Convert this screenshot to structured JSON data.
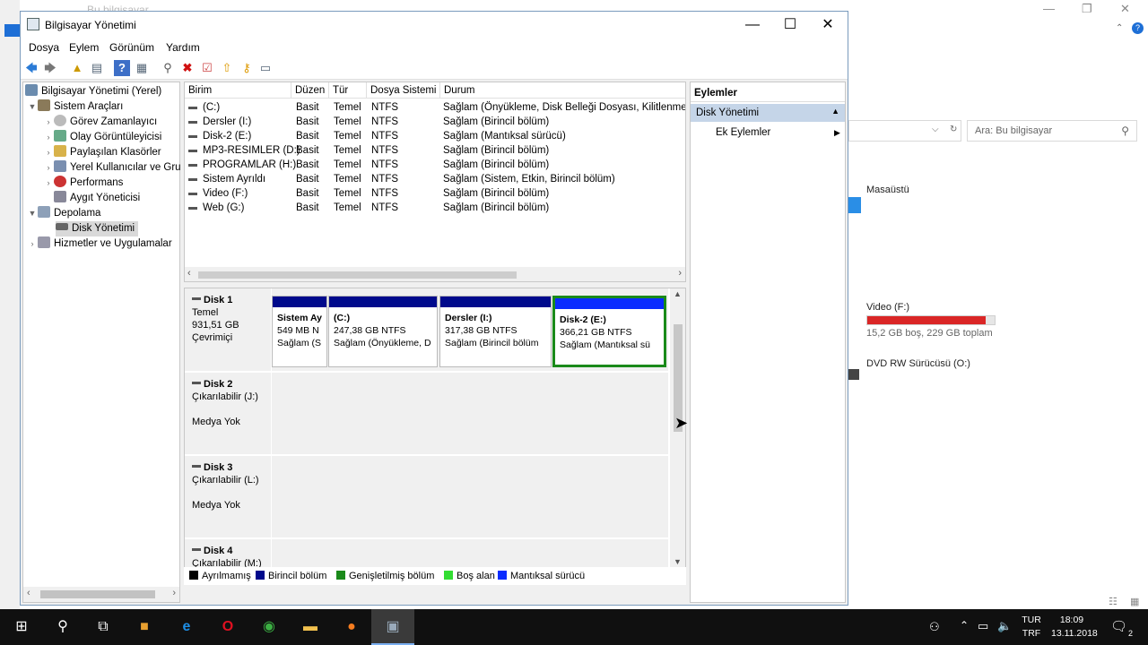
{
  "background_window": {
    "title": "Bu bilgisayar",
    "search_placeholder": "Ara: Bu bilgisayar",
    "items": {
      "desktop": "Masaüstü",
      "video_drive": "Video (F:)",
      "video_free": "15,2 GB boş, 229 GB toplam",
      "video_used_fraction": 0.93,
      "dvd": "DVD RW Sürücüsü (O:)"
    }
  },
  "window": {
    "title": "Bilgisayar Yönetimi",
    "menu": [
      "Dosya",
      "Eylem",
      "Görünüm",
      "Yardım"
    ]
  },
  "tree": {
    "root": "Bilgisayar Yönetimi (Yerel)",
    "items": [
      "Sistem Araçları",
      "Görev Zamanlayıcı",
      "Olay Görüntüleyicisi",
      "Paylaşılan Klasörler",
      "Yerel Kullanıcılar ve Gru",
      "Performans",
      "Aygıt Yöneticisi",
      "Depolama",
      "Disk Yönetimi",
      "Hizmetler ve Uygulamalar"
    ]
  },
  "volumes": {
    "columns": [
      "Birim",
      "Düzen",
      "Tür",
      "Dosya Sistemi",
      "Durum"
    ],
    "rows": [
      [
        "(C:)",
        "Basit",
        "Temel",
        "NTFS",
        "Sağlam (Önyükleme, Disk Belleği Dosyası, Kilitlenme B"
      ],
      [
        "Dersler (I:)",
        "Basit",
        "Temel",
        "NTFS",
        "Sağlam (Birincil bölüm)"
      ],
      [
        "Disk-2 (E:)",
        "Basit",
        "Temel",
        "NTFS",
        "Sağlam (Mantıksal sürücü)"
      ],
      [
        "MP3-RESIMLER (D:)",
        "Basit",
        "Temel",
        "NTFS",
        "Sağlam (Birincil bölüm)"
      ],
      [
        "PROGRAMLAR (H:)",
        "Basit",
        "Temel",
        "NTFS",
        "Sağlam (Birincil bölüm)"
      ],
      [
        "Sistem Ayrıldı",
        "Basit",
        "Temel",
        "NTFS",
        "Sağlam (Sistem, Etkin, Birincil bölüm)"
      ],
      [
        "Video (F:)",
        "Basit",
        "Temel",
        "NTFS",
        "Sağlam (Birincil bölüm)"
      ],
      [
        "Web (G:)",
        "Basit",
        "Temel",
        "NTFS",
        "Sağlam (Birincil bölüm)"
      ]
    ]
  },
  "disks": {
    "disk1": {
      "name": "Disk 1",
      "type": "Temel",
      "size": "931,51 GB",
      "status": "Çevrimiçi"
    },
    "disk1_parts": [
      {
        "name": "Sistem Ay",
        "size": "549 MB N",
        "status": "Sağlam (S"
      },
      {
        "name": "(C:)",
        "size": "247,38 GB NTFS",
        "status": "Sağlam (Önyükleme, D"
      },
      {
        "name": "Dersler  (I:)",
        "size": "317,38 GB NTFS",
        "status": "Sağlam (Birincil bölüm"
      },
      {
        "name": "Disk-2  (E:)",
        "size": "366,21 GB NTFS",
        "status": "Sağlam (Mantıksal sü"
      }
    ],
    "disk2": {
      "name": "Disk 2",
      "type": "Çıkarılabilir (J:)",
      "media": "Medya Yok"
    },
    "disk3": {
      "name": "Disk 3",
      "type": "Çıkarılabilir (L:)",
      "media": "Medya Yok"
    },
    "disk4": {
      "name": "Disk 4",
      "type": "Çıkarılabilir (M:)"
    }
  },
  "legend": [
    {
      "label": "Ayrılmamış",
      "color": "#000000"
    },
    {
      "label": "Birincil bölüm",
      "color": "#000a8c"
    },
    {
      "label": "Genişletilmiş bölüm",
      "color": "#1a8a1a"
    },
    {
      "label": "Boş alan",
      "color": "#33dd33"
    },
    {
      "label": "Mantıksal sürücü",
      "color": "#0a2cff"
    }
  ],
  "actions": {
    "header": "Eylemler",
    "group": "Disk Yönetimi",
    "item": "Ek Eylemler"
  },
  "taskbar": {
    "lang1": "TUR",
    "lang2": "TRF",
    "time": "18:09",
    "date": "13.11.2018",
    "notif_count": "2"
  }
}
